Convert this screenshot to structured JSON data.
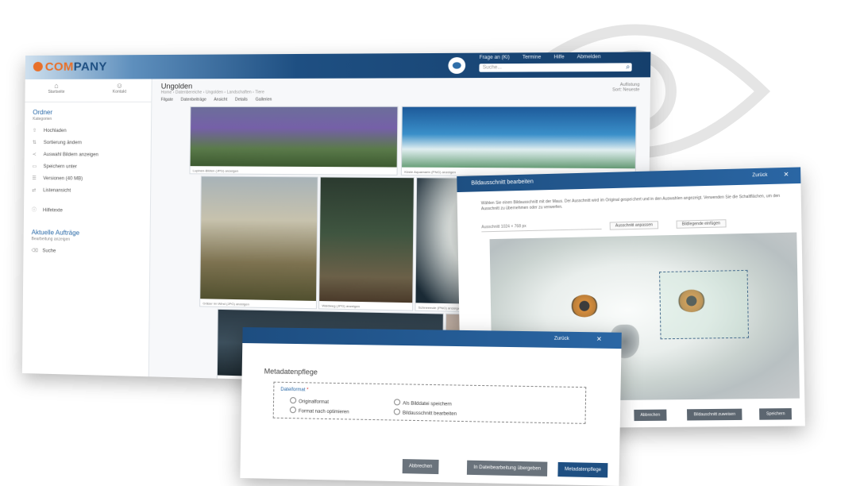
{
  "app": {
    "logo_text_co": "COM",
    "logo_text_rest": "PANY",
    "top_links": [
      "Frage an (Ki)",
      "Termine",
      "Hilfe",
      "Abmelden"
    ],
    "search_placeholder": "Suche..."
  },
  "sidebar": {
    "top_items": [
      {
        "icon": "home-icon",
        "glyph": "⌂",
        "label": "Startseite"
      },
      {
        "icon": "user-icon",
        "glyph": "☺",
        "label": "Kontakt"
      }
    ],
    "section_title": "Ordner",
    "section_sub": "Kategorien",
    "items": [
      {
        "icon": "upload-icon",
        "glyph": "⇧",
        "label": "Hochladen"
      },
      {
        "icon": "sort-icon",
        "glyph": "⇅",
        "label": "Sortierung ändern"
      },
      {
        "icon": "share-icon",
        "glyph": "≺",
        "label": "Auswahl Bildern anzeigen"
      },
      {
        "icon": "folder-icon",
        "glyph": "▭",
        "label": "Speichern unter"
      },
      {
        "icon": "list-icon",
        "glyph": "☰",
        "label": "Versionen (40 MB)"
      },
      {
        "icon": "swap-icon",
        "glyph": "⇄",
        "label": "Listenansicht"
      },
      {
        "icon": "info-icon",
        "glyph": "ⓘ",
        "label": "Hilfetexte"
      }
    ],
    "section2_title": "Aktuelle Aufträge",
    "section2_sub": "Bearbeitung anzeigen",
    "extra": {
      "icon": "trash-icon",
      "glyph": "⌫",
      "label": "Suche"
    }
  },
  "content": {
    "title": "Ungolden",
    "breadcrumb": "Home › Datenbereiche › Ungolden › Landschaften › Tiere",
    "right_top": "Auflistung",
    "right_bottom": "Sort: Neueste",
    "tabs": [
      "Filgate",
      "Datenbeiträge",
      "Ansicht",
      "Details",
      "Gallerien"
    ],
    "photos": [
      {
        "caption": "Lupinen-Blüten (JPG) anzeigen"
      },
      {
        "caption": "Küste Aquamarin (PNG) anzeigen"
      },
      {
        "caption": "Gräser im Wind (JPG) anzeigen"
      },
      {
        "caption": "Waldweg (JPG) anzeigen"
      },
      {
        "caption": "Schneeeule (PNG) anzeigen"
      },
      {
        "caption": ""
      },
      {
        "caption": ""
      }
    ]
  },
  "owl_dialog": {
    "title": "Bildausschnitt bearbeiten",
    "right_link": "Zurück",
    "description": "Wählen Sie einen Bildausschnitt mit der Maus. Der Ausschnitt wird im Original gespeichert und in den Auswahlen angezeigt. Verwenden Sie die Schaltflächen, um den Ausschnitt zu übernehmen oder zu verwerfen.",
    "field_label": "Ausschnitt 1024 × 768 px",
    "btn1": "Ausschnitt anpassen",
    "btn2": "Bildlegende einfügen",
    "footer_buttons": [
      "Abbrechen",
      "Bildauschnitt zuweisen",
      "Speichern"
    ]
  },
  "meta_dialog": {
    "title_right": "Zurück",
    "heading": "Metadatenpflege",
    "group_label": "Dateiformat",
    "required_mark": "*",
    "options": [
      {
        "label": "Originalformat"
      },
      {
        "label": "Als Bilddatei speichern"
      },
      {
        "label": "Format nach optimieren"
      },
      {
        "label": "Bildausschnitt bearbeiten"
      }
    ],
    "buttons": [
      "Abbrechen",
      "In Dateibearbeitung übergeben",
      "Metadatenpflege"
    ]
  }
}
